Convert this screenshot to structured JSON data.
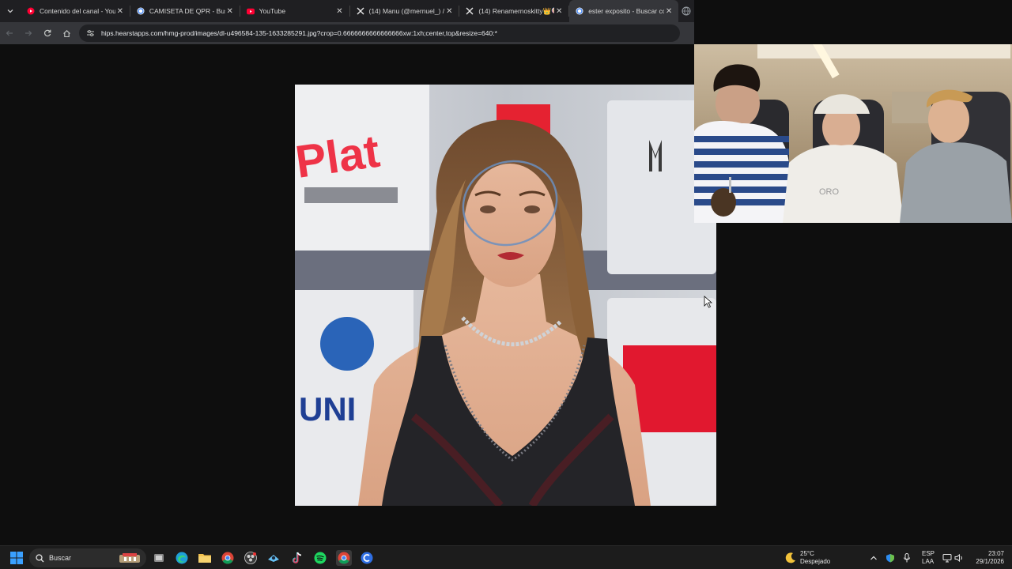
{
  "browser": {
    "tabs": [
      {
        "title": "Contenido del canal - You",
        "favicon": "youtube-studio-icon",
        "active": false
      },
      {
        "title": "CAMISETA DE QPR - Busc",
        "favicon": "google-icon",
        "active": false
      },
      {
        "title": "YouTube",
        "favicon": "youtube-icon",
        "active": false
      },
      {
        "title": "(14) Manu (@mernuel_) /",
        "favicon": "x-icon",
        "active": false
      },
      {
        "title": "(14) Renamernoskitty👑🍭",
        "favicon": "x-icon",
        "active": false
      },
      {
        "title": "ester exposito - Buscar co",
        "favicon": "google-icon",
        "active": true
      }
    ],
    "address_bar": {
      "url": "hips.hearstapps.com/hmg-prod/images/dl-u496584-135-1633285291.jpg?crop=0.6666666666666666xw:1xh;center,top&resize=640:*"
    }
  },
  "taskbar": {
    "search_placeholder": "Buscar",
    "weather": {
      "temp": "25°C",
      "condition": "Despejado"
    },
    "language": {
      "line1": "ESP",
      "line2": "LAA"
    },
    "clock": {
      "time": "23:07",
      "date": "29/1/2026"
    }
  },
  "colors": {
    "tab_strip": "#1f1f22",
    "toolbar": "#35363a",
    "page_background": "#0e0e0e",
    "taskbar": "#1c1c1c"
  }
}
